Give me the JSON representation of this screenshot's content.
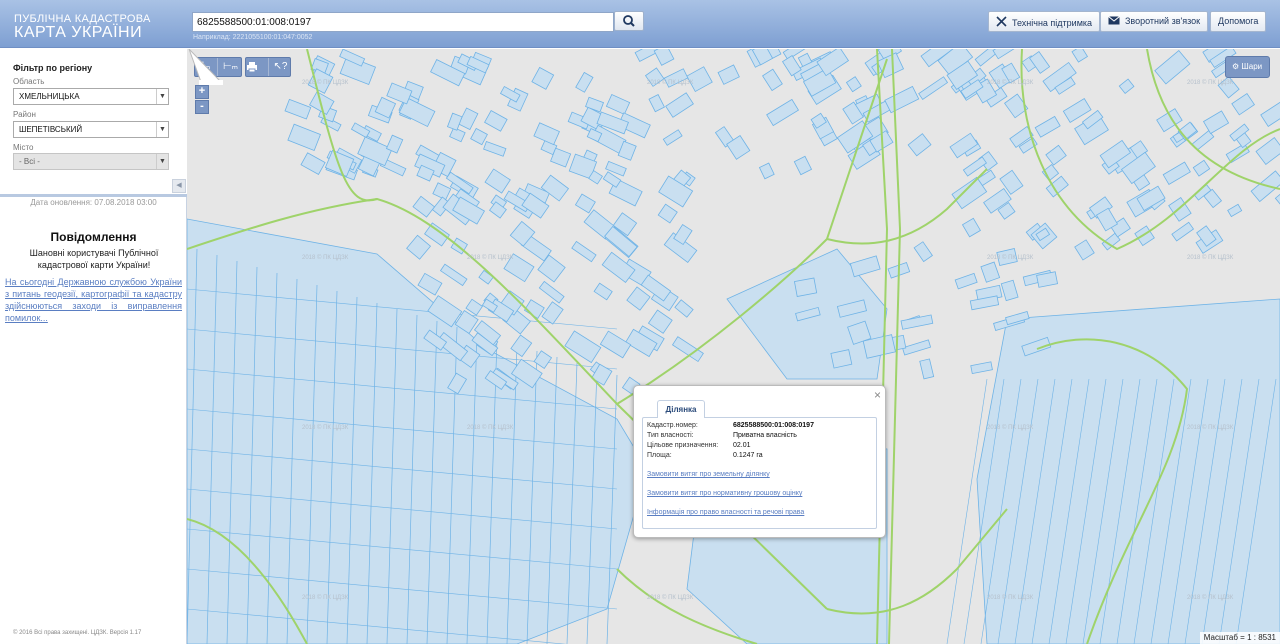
{
  "header": {
    "logo_small": "ПУБЛІЧНА КАДАСТРОВА",
    "logo_big": "КАРТА УКРАЇНИ",
    "search_value": "6825588500:01:008:0197",
    "search_hint": "Наприклад: 2221055100:01:047:0052",
    "support_label": "Технічна підтримка",
    "feedback_label": "Зворотний зв'язок",
    "help_label": "Допомога"
  },
  "filter": {
    "title": "Фільтр по регіону",
    "region_label": "Область",
    "region_value": "ХМЕЛЬНИЦЬКА",
    "district_label": "Район",
    "district_value": "ШЕПЕТІВСЬКИЙ",
    "city_label": "Місто",
    "city_value": "- Всі -"
  },
  "sidebar": {
    "update_date": "Дата оновлення: 07.08.2018 03:00",
    "notice_title": "Повідомлення",
    "notice_text": "Шановні користувачі Публічної кадастрової карти України!",
    "notice_link": "На сьогодні Державною службою України з питань геодезії, картографії та кадастру здійснюються заходи із виправлення помилок...",
    "copyright": "© 2016 Всі права захищені. ЦДЗК. Версія 1.17"
  },
  "map": {
    "layers_label": "Шари",
    "zoom_in": "+",
    "zoom_out": "-",
    "scale_text": "Масштаб = 1 : 8531",
    "watermark": "2018 © ПК ЦДЗК",
    "parcel_fill": "#c9dff0",
    "parcel_stroke": "#6fb3e6",
    "boundary_color": "#9fd36a",
    "background": "#e6e6e6"
  },
  "popup": {
    "tab_label": "Ділянка",
    "rows": [
      {
        "label": "Кадастр.номер:",
        "value": "6825588500:01:008:0197"
      },
      {
        "label": "Тип власності:",
        "value": "Приватна власність"
      },
      {
        "label": "Цільове призначення:",
        "value": "02.01"
      },
      {
        "label": "Площа:",
        "value": "0.1247 га"
      }
    ],
    "links": [
      "Замовити витяг про земельну ділянку",
      "Замовити витяг про нормативну грошову оцінку",
      "Інформація про право власності та речові права"
    ],
    "close": "×"
  }
}
